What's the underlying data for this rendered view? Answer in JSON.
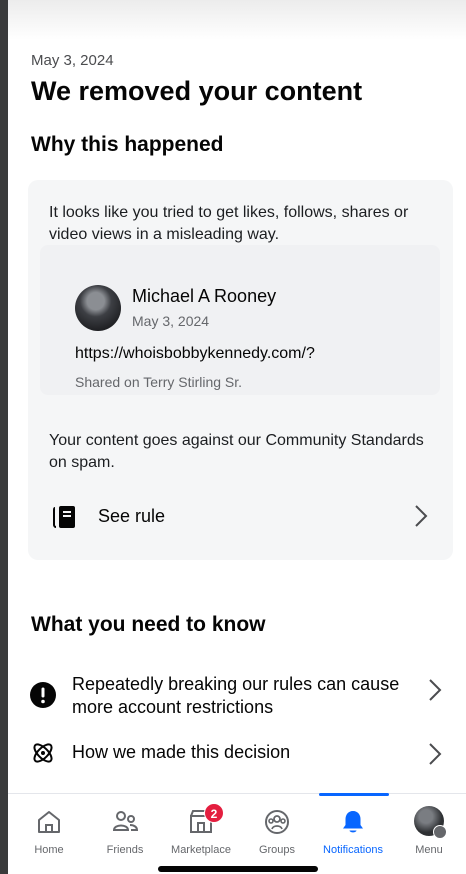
{
  "header": {
    "date": "May 3, 2024",
    "title": "We removed your content"
  },
  "why": {
    "heading": "Why this happened",
    "intro": "It looks like you tried to get likes, follows, shares or video views in a misleading way.",
    "post": {
      "author": "Michael A Rooney",
      "date": "May 3, 2024",
      "link": "https://whoisbobbykennedy.com/?",
      "shared_on": "Shared on Terry Stirling Sr."
    },
    "violation_text": "Your content goes against our Community Standards on spam.",
    "see_rule_label": "See rule",
    "see_rule_icon": "book-icon"
  },
  "know": {
    "heading": "What you need to know",
    "items": [
      {
        "icon": "exclamation-circle-icon",
        "label": "Repeatedly breaking our rules can cause more account restrictions"
      },
      {
        "icon": "atom-icon",
        "label": "How we made this decision"
      }
    ]
  },
  "tabbar": {
    "tabs": [
      {
        "icon": "home-icon",
        "label": "Home"
      },
      {
        "icon": "friends-icon",
        "label": "Friends"
      },
      {
        "icon": "marketplace-icon",
        "label": "Marketplace",
        "badge": "2"
      },
      {
        "icon": "groups-icon",
        "label": "Groups"
      },
      {
        "icon": "bell-icon",
        "label": "Notifications",
        "active": true
      },
      {
        "icon": "profile-avatar",
        "label": "Menu"
      }
    ]
  },
  "colors": {
    "accent": "#0866ff",
    "badge": "#e41e3f",
    "card_bg": "#f5f6f7",
    "text_secondary": "#65676b"
  }
}
